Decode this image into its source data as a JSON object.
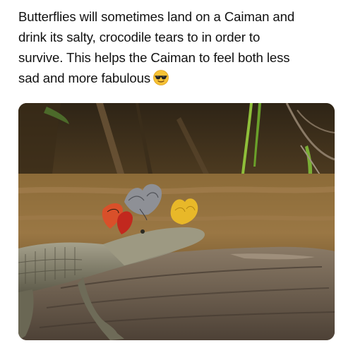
{
  "post": {
    "caption_lines": [
      "Butterflies will sometimes land on a Caiman and",
      "drink its salty, crocodile tears to in order to",
      "survive. This helps the Caiman to feel both less",
      "sad and more fabulous"
    ],
    "emoji": "smiling-face-with-sunglasses-emoji"
  },
  "photo": {
    "subject": "caiman-with-butterflies",
    "colors": {
      "water": "#8a6a3a",
      "log": "#6b5b4c",
      "caiman": "#8d8a72",
      "butterfly_orange": "#d9502a",
      "butterfly_red": "#c2281e",
      "butterfly_yellow": "#e8b829",
      "butterfly_gray": "#8e9096"
    }
  }
}
